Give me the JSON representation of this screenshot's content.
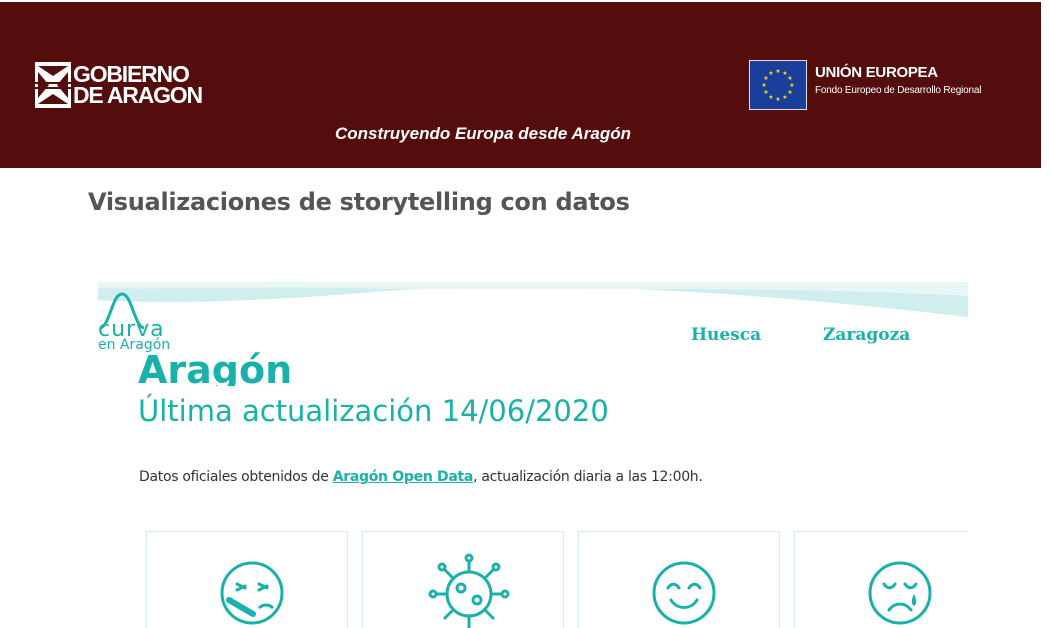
{
  "header": {
    "gov_logo_line1": "GOBIERNO",
    "gov_logo_line2": "DE ARAGON",
    "eu_title": "UNIÓN EUROPEA",
    "eu_subtitle": "Fondo Europeo de Desarrollo Regional",
    "motto": "Construyendo Europa desde Aragón"
  },
  "page_title": "Visualizaciones de storytelling con datos",
  "embed": {
    "logo_word": "curva",
    "logo_sub": "en Aragón",
    "nav": [
      {
        "label": "Huesca"
      },
      {
        "label": "Zaragoza"
      }
    ],
    "region_title": "Aragón",
    "updated": "Última actualización 14/06/2020",
    "source_prefix": "Datos oficiales obtenidos de ",
    "source_link": "Aragón Open Data",
    "source_suffix": ", actualización diaria a las 12:00h.",
    "cards": [
      {
        "icon": "sick-face-icon"
      },
      {
        "icon": "virus-icon"
      },
      {
        "icon": "smiling-face-icon"
      },
      {
        "icon": "crying-face-icon"
      }
    ]
  },
  "colors": {
    "banner": "#540d0d",
    "teal": "#1ab1aa",
    "heading": "#555555"
  }
}
